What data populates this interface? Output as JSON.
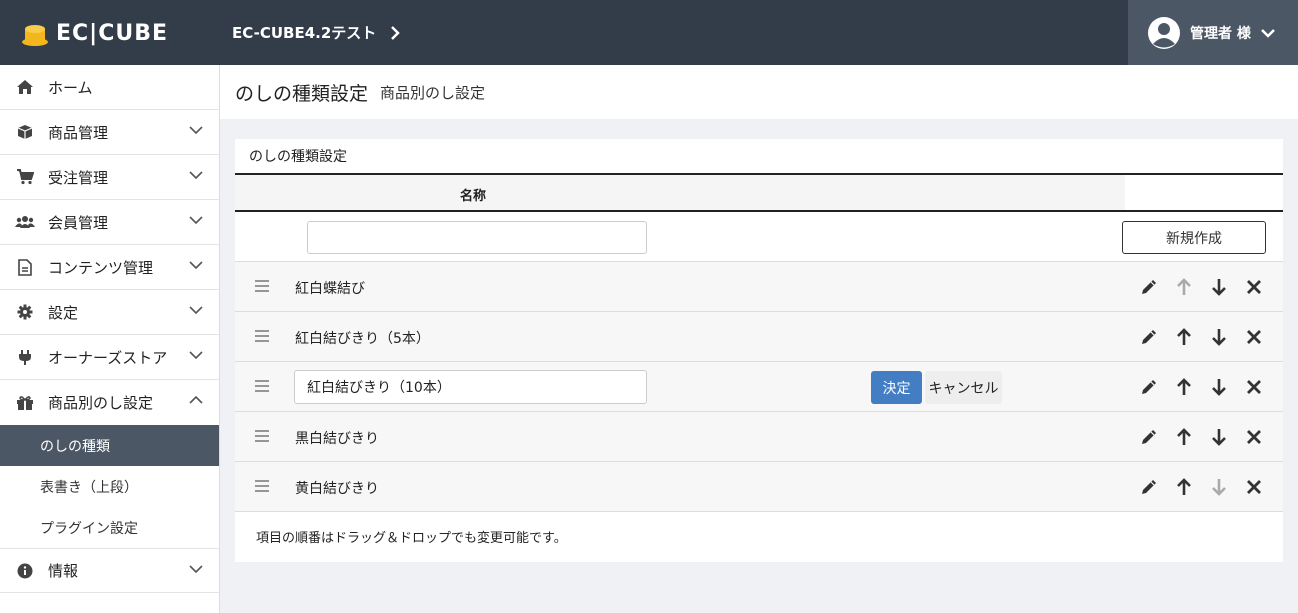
{
  "header": {
    "logo_text": "EC|CUBE",
    "shop_name": "EC-CUBE4.2テスト",
    "user_name": "管理者 様"
  },
  "sidebar": {
    "items": [
      {
        "label": "ホーム",
        "icon": "home-icon"
      },
      {
        "label": "商品管理",
        "icon": "cube-icon"
      },
      {
        "label": "受注管理",
        "icon": "cart-icon"
      },
      {
        "label": "会員管理",
        "icon": "users-icon"
      },
      {
        "label": "コンテンツ管理",
        "icon": "file-icon"
      },
      {
        "label": "設定",
        "icon": "gear-icon"
      },
      {
        "label": "オーナーズストア",
        "icon": "plug-icon"
      },
      {
        "label": "商品別のし設定",
        "icon": "gift-icon"
      }
    ],
    "sub_items": [
      {
        "label": "のしの種類",
        "active": true
      },
      {
        "label": "表書き（上段）",
        "active": false
      },
      {
        "label": "プラグイン設定",
        "active": false
      }
    ],
    "last_item": {
      "label": "情報",
      "icon": "info-icon"
    }
  },
  "page": {
    "title": "のしの種類設定",
    "subtitle": "商品別のし設定"
  },
  "card": {
    "title": "のしの種類設定",
    "column_name": "名称",
    "new_button": "新規作成",
    "new_input_value": "",
    "rows": [
      {
        "name": "紅白蝶結び",
        "editing": false
      },
      {
        "name": "紅白結びきり（5本）",
        "editing": false
      },
      {
        "name": "紅白結びきり（10本）",
        "editing": true
      },
      {
        "name": "黒白結びきり",
        "editing": false
      },
      {
        "name": "黄白結びきり",
        "editing": false
      }
    ],
    "ok_button": "決定",
    "cancel_button": "キャンセル",
    "note": "項目の順番はドラッグ＆ドロップでも変更可能です。"
  },
  "colors": {
    "header_bg": "#333d4a",
    "user_bg": "#4c5766",
    "primary": "#437ec4",
    "logo_gold": "#f3b61c"
  }
}
